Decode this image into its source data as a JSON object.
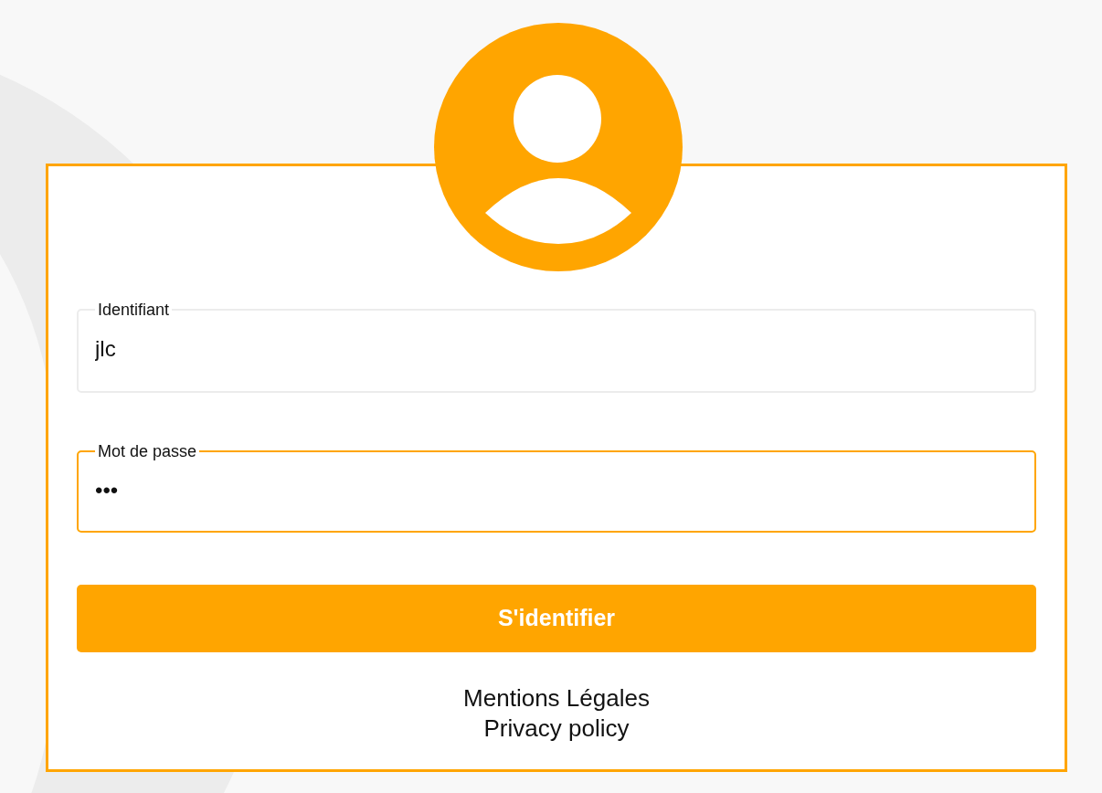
{
  "fields": [
    {
      "label": "Identifiant",
      "value": "jlc",
      "focused": false
    },
    {
      "label": "Mot de passe",
      "value": "•••",
      "focused": true
    }
  ],
  "submit_button": "S'identifier",
  "footer_links": [
    "Mentions Légales",
    "Privacy policy"
  ]
}
